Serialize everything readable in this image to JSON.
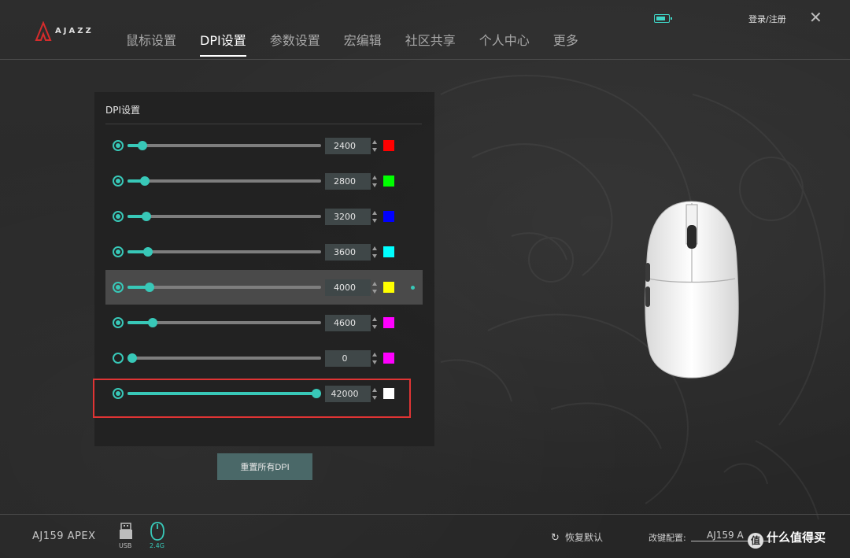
{
  "header": {
    "brand": "AJAZZ",
    "tabs": [
      {
        "label": "鼠标设置",
        "active": false
      },
      {
        "label": "DPI设置",
        "active": true
      },
      {
        "label": "参数设置",
        "active": false
      },
      {
        "label": "宏编辑",
        "active": false
      },
      {
        "label": "社区共享",
        "active": false
      },
      {
        "label": "个人中心",
        "active": false
      },
      {
        "label": "更多",
        "active": false
      }
    ],
    "login_label": "登录/注册",
    "close_icon": "close-icon",
    "battery_icon": "battery-icon"
  },
  "dpi_panel": {
    "title": "DPI设置",
    "max_dpi": 42000,
    "rows": [
      {
        "value": "2400",
        "color": "#ff0000",
        "enabled": true,
        "selected": false
      },
      {
        "value": "2800",
        "color": "#00ff00",
        "enabled": true,
        "selected": false
      },
      {
        "value": "3200",
        "color": "#0000ff",
        "enabled": true,
        "selected": false
      },
      {
        "value": "3600",
        "color": "#00ffff",
        "enabled": true,
        "selected": false
      },
      {
        "value": "4000",
        "color": "#ffff00",
        "enabled": true,
        "selected": true
      },
      {
        "value": "4600",
        "color": "#ff00ff",
        "enabled": true,
        "selected": false
      },
      {
        "value": "0",
        "color": "#ff00ff",
        "enabled": false,
        "selected": false
      },
      {
        "value": "42000",
        "color": "#ffffff",
        "enabled": true,
        "selected": false
      }
    ],
    "reset_label": "重置所有DPI"
  },
  "footer": {
    "model": "AJ159 APEX",
    "usb_label": "USB",
    "wireless_label": "2.4G",
    "restore_label": "恢复默认",
    "config_label": "改键配置:",
    "config_value": "AJ159 A",
    "watermark": "什么值得买",
    "watermark_glyph": "值"
  },
  "colors": {
    "accent": "#38c8b8",
    "highlight_row": "#4a4a4a",
    "annotation_box": "#e03434"
  }
}
